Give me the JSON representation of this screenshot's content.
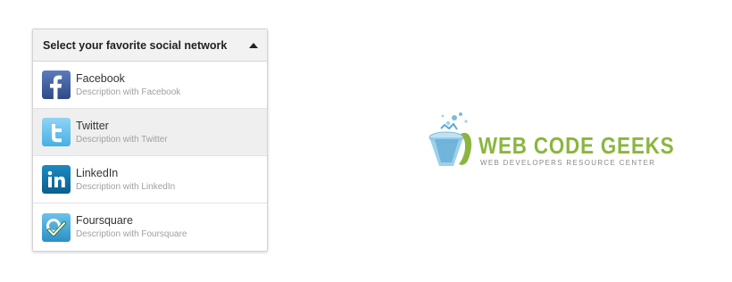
{
  "dropdown": {
    "title": "Select your favorite social network",
    "items": [
      {
        "name": "Facebook",
        "description": "Description with Facebook",
        "icon": "facebook-icon",
        "color": "#3b5998"
      },
      {
        "name": "Twitter",
        "description": "Description with Twitter",
        "icon": "twitter-icon",
        "color": "#55acee"
      },
      {
        "name": "LinkedIn",
        "description": "Description with LinkedIn",
        "icon": "linkedin-icon",
        "color": "#0e76a8"
      },
      {
        "name": "Foursquare",
        "description": "Description with Foursquare",
        "icon": "foursquare-icon",
        "color": "#4aa7d9"
      }
    ]
  },
  "logo": {
    "title": "WEB CODE GEEKS",
    "subtitle": "WEB DEVELOPERS RESOURCE CENTER",
    "color": "#8ab63f"
  }
}
